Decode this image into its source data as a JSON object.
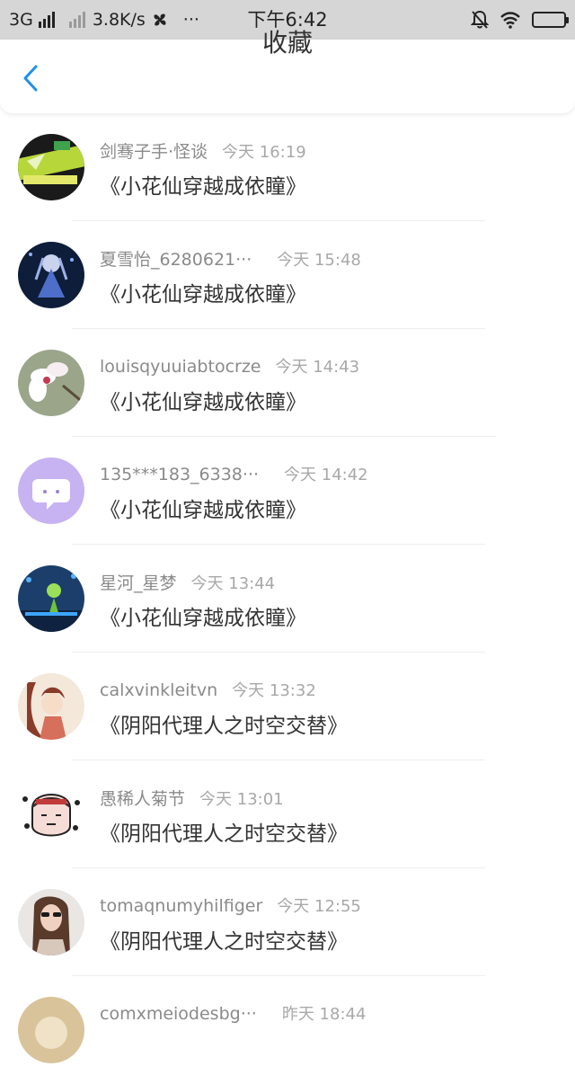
{
  "status_bar": {
    "network": "3G",
    "speed": "3.8K/s",
    "more": "···",
    "time": "下午6:42"
  },
  "nav": {
    "title": "收藏",
    "back_icon": "chevron-left-icon",
    "accent_color": "#1e90e8"
  },
  "items": [
    {
      "username": "剑骞子手·怪谈",
      "time": "今天 16:19",
      "title": "《小花仙穿越成依瞳》",
      "avatar": "anime-green-avatar"
    },
    {
      "username": "夏雪怡_6280621···",
      "time": "今天 15:48",
      "title": "《小花仙穿越成依瞳》",
      "avatar": "anime-blue-girl-avatar"
    },
    {
      "username": "louisqyuuiabtocrze",
      "time": "今天 14:43",
      "title": "《小花仙穿越成依瞳》",
      "avatar": "flower-avatar"
    },
    {
      "username": "135***183_6338···",
      "time": "今天 14:42",
      "title": "《小花仙穿越成依瞳》",
      "avatar": "default-chat-avatar"
    },
    {
      "username": "星河_星梦",
      "time": "今天 13:44",
      "title": "《小花仙穿越成依瞳》",
      "avatar": "stage-character-avatar"
    },
    {
      "username": "calxvinkleitvn",
      "time": "今天 13:32",
      "title": "《阴阳代理人之时空交替》",
      "avatar": "anime-girl-avatar"
    },
    {
      "username": "愚稀人菊节",
      "time": "今天 13:01",
      "title": "《阴阳代理人之时空交替》",
      "avatar": "cartoon-face-avatar"
    },
    {
      "username": "tomaqnumyhilfiger",
      "time": "今天 12:55",
      "title": "《阴阳代理人之时空交替》",
      "avatar": "woman-sunglasses-avatar"
    },
    {
      "username": "comxmeiodesbg···",
      "time": "昨天 18:44",
      "title": "",
      "avatar": "beige-avatar"
    }
  ]
}
